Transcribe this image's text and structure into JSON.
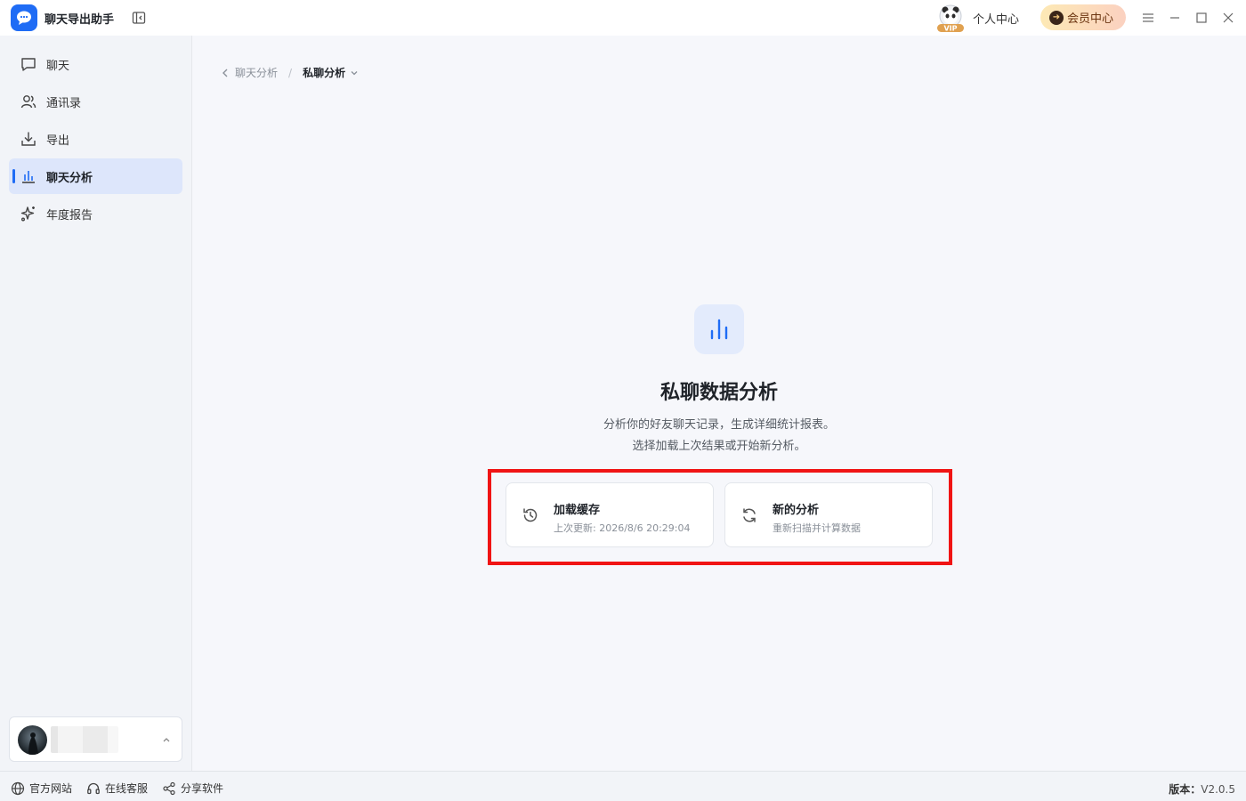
{
  "app": {
    "title": "聊天导出助手"
  },
  "header": {
    "user_center": "个人中心",
    "member_center": "会员中心",
    "vip_badge": "VIP"
  },
  "sidebar": {
    "items": [
      {
        "label": "聊天",
        "icon": "chat-bubble-icon"
      },
      {
        "label": "通讯录",
        "icon": "contacts-icon"
      },
      {
        "label": "导出",
        "icon": "download-icon"
      },
      {
        "label": "聊天分析",
        "icon": "bar-chart-icon",
        "active": true
      },
      {
        "label": "年度报告",
        "icon": "sparkle-icon"
      }
    ]
  },
  "breadcrumb": {
    "parent": "聊天分析",
    "separator": "/",
    "current": "私聊分析"
  },
  "main": {
    "title": "私聊数据分析",
    "description_line1": "分析你的好友聊天记录，生成详细统计报表。",
    "description_line2": "选择加载上次结果或开始新分析。",
    "cards": [
      {
        "title": "加载缓存",
        "subtitle": "上次更新: 2026/8/6 20:29:04",
        "icon": "history-icon"
      },
      {
        "title": "新的分析",
        "subtitle": "重新扫描并计算数据",
        "icon": "refresh-icon"
      }
    ]
  },
  "footer": {
    "links": [
      {
        "label": "官方网站",
        "icon": "globe-icon"
      },
      {
        "label": "在线客服",
        "icon": "headset-icon"
      },
      {
        "label": "分享软件",
        "icon": "share-icon"
      }
    ],
    "version_label": "版本：",
    "version_value": "V2.0.5"
  },
  "colors": {
    "accent": "#1f6cf5",
    "highlight": "#f01414",
    "active_nav_bg": "#dde6fb"
  }
}
